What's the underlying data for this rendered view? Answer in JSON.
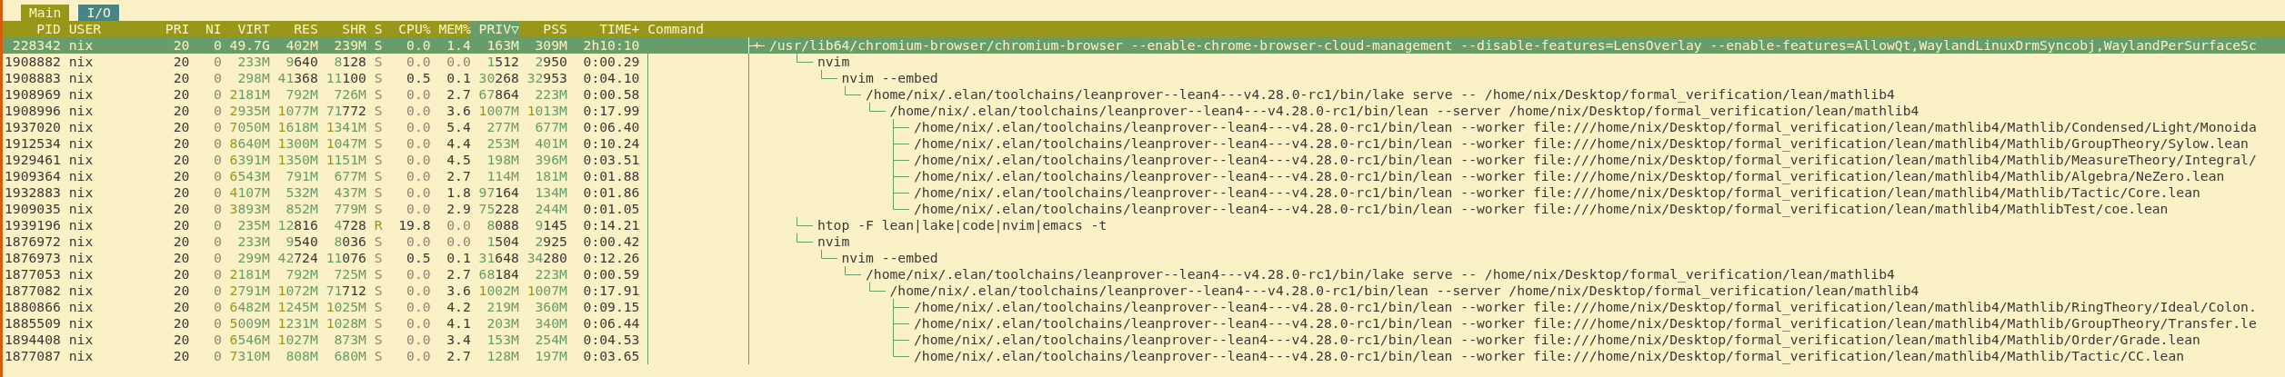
{
  "tabs": [
    {
      "label": "Main",
      "selected": true
    },
    {
      "label": "I/O",
      "selected": false
    }
  ],
  "columns": [
    {
      "label": "PID",
      "sorted": false
    },
    {
      "label": "USER",
      "sorted": false
    },
    {
      "label": "PRI",
      "sorted": false
    },
    {
      "label": "NI",
      "sorted": false
    },
    {
      "label": "VIRT",
      "sorted": false
    },
    {
      "label": "RES",
      "sorted": false
    },
    {
      "label": "SHR",
      "sorted": false
    },
    {
      "label": "S",
      "sorted": false
    },
    {
      "label": "CPU%",
      "sorted": false
    },
    {
      "label": "MEM%",
      "sorted": false
    },
    {
      "label": "PRIV▽",
      "sorted": true
    },
    {
      "label": "PSS",
      "sorted": false
    },
    {
      "label": "TIME+",
      "sorted": false
    },
    {
      "label": "Command",
      "sorted": false
    }
  ],
  "processes": [
    {
      "pid": "228342",
      "user": "nix",
      "pri": "20",
      "ni": "0",
      "virt": "49.7G",
      "res": "402M",
      "shr": "239M",
      "state": "S",
      "running": false,
      "cpu": "0.0",
      "mem": "1.4",
      "priv": "163M",
      "pss": "309M",
      "time": "2h10:10",
      "command": "/usr/lib64/chromium-browser/chromium-browser --enable-chrome-browser-cloud-management --disable-features=LensOverlay --enable-features=AllowQt,WaylandLinuxDrmSyncobj,WaylandPerSurfaceSc",
      "selected": true,
      "collapsed": true
    },
    {
      "pid": "1908882",
      "user": "nix",
      "pri": "20",
      "ni": "0",
      "virt": "233M",
      "res": "9640",
      "shr": "8128",
      "state": "S",
      "running": false,
      "cpu": "0.0",
      "mem": "0.0",
      "priv": "1512",
      "pss": "2950",
      "time": "0:00.29",
      "command": "nvim",
      "selected": false,
      "collapsed": false,
      "children": [
        {
          "pid": "1908883",
          "user": "nix",
          "pri": "20",
          "ni": "0",
          "virt": "298M",
          "res": "41368",
          "shr": "11100",
          "state": "S",
          "running": false,
          "cpu": "0.5",
          "mem": "0.1",
          "priv": "30268",
          "pss": "32953",
          "time": "0:04.10",
          "command": "nvim --embed",
          "selected": false,
          "collapsed": false,
          "children": [
            {
              "pid": "1908969",
              "user": "nix",
              "pri": "20",
              "ni": "0",
              "virt": "2181M",
              "res": "792M",
              "shr": "726M",
              "state": "S",
              "running": false,
              "cpu": "0.0",
              "mem": "2.7",
              "priv": "67864",
              "pss": "223M",
              "time": "0:00.58",
              "command": "/home/nix/.elan/toolchains/leanprover--lean4---v4.28.0-rc1/bin/lake serve -- /home/nix/Desktop/formal_verification/lean/mathlib4",
              "selected": false,
              "collapsed": false,
              "children": [
                {
                  "pid": "1908996",
                  "user": "nix",
                  "pri": "20",
                  "ni": "0",
                  "virt": "2935M",
                  "res": "1077M",
                  "shr": "71772",
                  "state": "S",
                  "running": false,
                  "cpu": "0.0",
                  "mem": "3.6",
                  "priv": "1007M",
                  "pss": "1013M",
                  "time": "0:17.99",
                  "command": "/home/nix/.elan/toolchains/leanprover--lean4---v4.28.0-rc1/bin/lean --server /home/nix/Desktop/formal_verification/lean/mathlib4",
                  "selected": false,
                  "collapsed": false,
                  "children": [
                    {
                      "pid": "1937020",
                      "user": "nix",
                      "pri": "20",
                      "ni": "0",
                      "virt": "7050M",
                      "res": "1618M",
                      "shr": "1341M",
                      "state": "S",
                      "running": false,
                      "cpu": "0.0",
                      "mem": "5.4",
                      "priv": "277M",
                      "pss": "677M",
                      "time": "0:06.40",
                      "command": "/home/nix/.elan/toolchains/leanprover--lean4---v4.28.0-rc1/bin/lean --worker file:///home/nix/Desktop/formal_verification/lean/mathlib4/Mathlib/Condensed/Light/Monoida",
                      "selected": false,
                      "collapsed": false
                    },
                    {
                      "pid": "1912534",
                      "user": "nix",
                      "pri": "20",
                      "ni": "0",
                      "virt": "8640M",
                      "res": "1300M",
                      "shr": "1047M",
                      "state": "S",
                      "running": false,
                      "cpu": "0.0",
                      "mem": "4.4",
                      "priv": "253M",
                      "pss": "401M",
                      "time": "0:10.24",
                      "command": "/home/nix/.elan/toolchains/leanprover--lean4---v4.28.0-rc1/bin/lean --worker file:///home/nix/Desktop/formal_verification/lean/mathlib4/Mathlib/GroupTheory/Sylow.lean",
                      "selected": false,
                      "collapsed": false
                    },
                    {
                      "pid": "1929461",
                      "user": "nix",
                      "pri": "20",
                      "ni": "0",
                      "virt": "6391M",
                      "res": "1350M",
                      "shr": "1151M",
                      "state": "S",
                      "running": false,
                      "cpu": "0.0",
                      "mem": "4.5",
                      "priv": "198M",
                      "pss": "396M",
                      "time": "0:03.51",
                      "command": "/home/nix/.elan/toolchains/leanprover--lean4---v4.28.0-rc1/bin/lean --worker file:///home/nix/Desktop/formal_verification/lean/mathlib4/Mathlib/MeasureTheory/Integral/",
                      "selected": false,
                      "collapsed": false
                    },
                    {
                      "pid": "1909364",
                      "user": "nix",
                      "pri": "20",
                      "ni": "0",
                      "virt": "6543M",
                      "res": "791M",
                      "shr": "677M",
                      "state": "S",
                      "running": false,
                      "cpu": "0.0",
                      "mem": "2.7",
                      "priv": "114M",
                      "pss": "181M",
                      "time": "0:01.88",
                      "command": "/home/nix/.elan/toolchains/leanprover--lean4---v4.28.0-rc1/bin/lean --worker file:///home/nix/Desktop/formal_verification/lean/mathlib4/Mathlib/Algebra/NeZero.lean",
                      "selected": false,
                      "collapsed": false
                    },
                    {
                      "pid": "1932883",
                      "user": "nix",
                      "pri": "20",
                      "ni": "0",
                      "virt": "4107M",
                      "res": "532M",
                      "shr": "437M",
                      "state": "S",
                      "running": false,
                      "cpu": "0.0",
                      "mem": "1.8",
                      "priv": "97164",
                      "pss": "134M",
                      "time": "0:01.86",
                      "command": "/home/nix/.elan/toolchains/leanprover--lean4---v4.28.0-rc1/bin/lean --worker file:///home/nix/Desktop/formal_verification/lean/mathlib4/Mathlib/Tactic/Core.lean",
                      "selected": false,
                      "collapsed": false
                    },
                    {
                      "pid": "1909035",
                      "user": "nix",
                      "pri": "20",
                      "ni": "0",
                      "virt": "3893M",
                      "res": "852M",
                      "shr": "779M",
                      "state": "S",
                      "running": false,
                      "cpu": "0.0",
                      "mem": "2.9",
                      "priv": "75228",
                      "pss": "244M",
                      "time": "0:01.05",
                      "command": "/home/nix/.elan/toolchains/leanprover--lean4---v4.28.0-rc1/bin/lean --worker file:///home/nix/Desktop/formal_verification/lean/mathlib4/MathlibTest/coe.lean",
                      "selected": false,
                      "collapsed": false
                    }
                  ]
                }
              ]
            }
          ]
        }
      ]
    },
    {
      "pid": "1939196",
      "user": "nix",
      "pri": "20",
      "ni": "0",
      "virt": "235M",
      "res": "12816",
      "shr": "4728",
      "state": "R",
      "running": true,
      "cpu": "19.8",
      "mem": "0.0",
      "priv": "8088",
      "pss": "9145",
      "time": "0:14.21",
      "command": "htop -F lean|lake|code|nvim|emacs -t",
      "selected": false,
      "collapsed": false
    },
    {
      "pid": "1876972",
      "user": "nix",
      "pri": "20",
      "ni": "0",
      "virt": "233M",
      "res": "9540",
      "shr": "8036",
      "state": "S",
      "running": false,
      "cpu": "0.0",
      "mem": "0.0",
      "priv": "1504",
      "pss": "2925",
      "time": "0:00.42",
      "command": "nvim",
      "selected": false,
      "collapsed": false,
      "children": [
        {
          "pid": "1876973",
          "user": "nix",
          "pri": "20",
          "ni": "0",
          "virt": "299M",
          "res": "42724",
          "shr": "11076",
          "state": "S",
          "running": false,
          "cpu": "0.5",
          "mem": "0.1",
          "priv": "31648",
          "pss": "34280",
          "time": "0:12.26",
          "command": "nvim --embed",
          "selected": false,
          "collapsed": false,
          "children": [
            {
              "pid": "1877053",
              "user": "nix",
              "pri": "20",
              "ni": "0",
              "virt": "2181M",
              "res": "792M",
              "shr": "725M",
              "state": "S",
              "running": false,
              "cpu": "0.0",
              "mem": "2.7",
              "priv": "68184",
              "pss": "223M",
              "time": "0:00.59",
              "command": "/home/nix/.elan/toolchains/leanprover--lean4---v4.28.0-rc1/bin/lake serve -- /home/nix/Desktop/formal_verification/lean/mathlib4",
              "selected": false,
              "collapsed": false,
              "children": [
                {
                  "pid": "1877082",
                  "user": "nix",
                  "pri": "20",
                  "ni": "0",
                  "virt": "2791M",
                  "res": "1072M",
                  "shr": "71712",
                  "state": "S",
                  "running": false,
                  "cpu": "0.0",
                  "mem": "3.6",
                  "priv": "1002M",
                  "pss": "1007M",
                  "time": "0:17.91",
                  "command": "/home/nix/.elan/toolchains/leanprover--lean4---v4.28.0-rc1/bin/lean --server /home/nix/Desktop/formal_verification/lean/mathlib4",
                  "selected": false,
                  "collapsed": false,
                  "children": [
                    {
                      "pid": "1880866",
                      "user": "nix",
                      "pri": "20",
                      "ni": "0",
                      "virt": "6482M",
                      "res": "1245M",
                      "shr": "1025M",
                      "state": "S",
                      "running": false,
                      "cpu": "0.0",
                      "mem": "4.2",
                      "priv": "219M",
                      "pss": "360M",
                      "time": "0:09.15",
                      "command": "/home/nix/.elan/toolchains/leanprover--lean4---v4.28.0-rc1/bin/lean --worker file:///home/nix/Desktop/formal_verification/lean/mathlib4/Mathlib/RingTheory/Ideal/Colon.",
                      "selected": false,
                      "collapsed": false
                    },
                    {
                      "pid": "1885509",
                      "user": "nix",
                      "pri": "20",
                      "ni": "0",
                      "virt": "5009M",
                      "res": "1231M",
                      "shr": "1028M",
                      "state": "S",
                      "running": false,
                      "cpu": "0.0",
                      "mem": "4.1",
                      "priv": "203M",
                      "pss": "340M",
                      "time": "0:06.44",
                      "command": "/home/nix/.elan/toolchains/leanprover--lean4---v4.28.0-rc1/bin/lean --worker file:///home/nix/Desktop/formal_verification/lean/mathlib4/Mathlib/GroupTheory/Transfer.le",
                      "selected": false,
                      "collapsed": false
                    },
                    {
                      "pid": "1894408",
                      "user": "nix",
                      "pri": "20",
                      "ni": "0",
                      "virt": "6546M",
                      "res": "1027M",
                      "shr": "873M",
                      "state": "S",
                      "running": false,
                      "cpu": "0.0",
                      "mem": "3.4",
                      "priv": "153M",
                      "pss": "254M",
                      "time": "0:04.53",
                      "command": "/home/nix/.elan/toolchains/leanprover--lean4---v4.28.0-rc1/bin/lean --worker file:///home/nix/Desktop/formal_verification/lean/mathlib4/Mathlib/Order/Grade.lean",
                      "selected": false,
                      "collapsed": false
                    },
                    {
                      "pid": "1877087",
                      "user": "nix",
                      "pri": "20",
                      "ni": "0",
                      "virt": "7310M",
                      "res": "808M",
                      "shr": "680M",
                      "state": "S",
                      "running": false,
                      "cpu": "0.0",
                      "mem": "2.7",
                      "priv": "128M",
                      "pss": "197M",
                      "time": "0:03.65",
                      "command": "/home/nix/.elan/toolchains/leanprover--lean4---v4.28.0-rc1/bin/lean --worker file:///home/nix/Desktop/formal_verification/lean/mathlib4/Mathlib/Tactic/CC.lean",
                      "selected": false,
                      "collapsed": false
                    }
                  ]
                }
              ]
            }
          ]
        }
      ]
    }
  ]
}
